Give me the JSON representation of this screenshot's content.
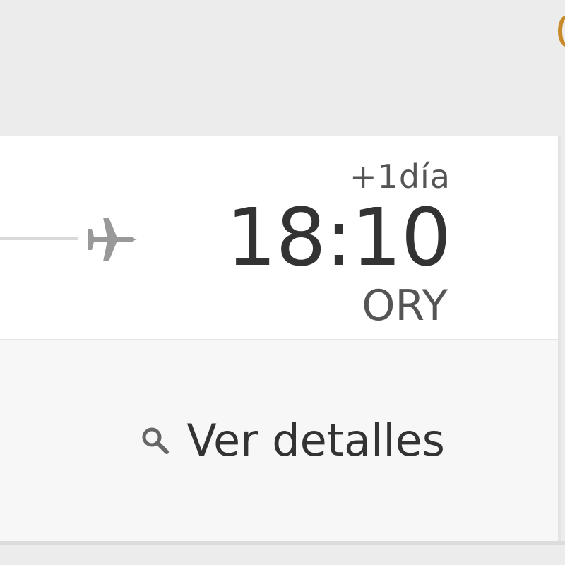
{
  "flight": {
    "arrival": {
      "day_offset": "+1día",
      "time": "18:10",
      "airport": "ORY"
    }
  },
  "actions": {
    "details_label": "Ver detalles",
    "details_icon": "search-icon"
  },
  "route": {
    "icon": "plane-icon"
  },
  "colors": {
    "background": "#ececec",
    "card": "#ffffff",
    "card_footer": "#f7f7f7",
    "text_primary": "#333333",
    "text_secondary": "#555555",
    "icon_gray": "#999999",
    "accent": "#c88a2a"
  }
}
